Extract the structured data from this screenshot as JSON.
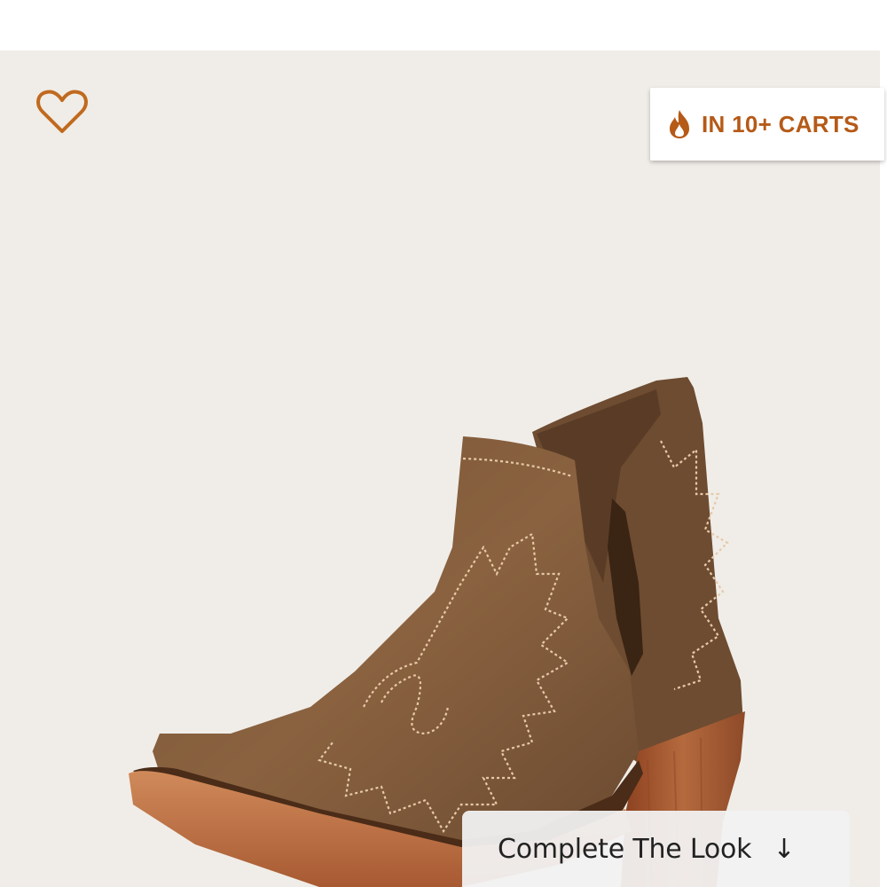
{
  "badge": {
    "text": "IN 10+ CARTS",
    "icon": "flame-icon",
    "color": "#b55a17"
  },
  "favorite": {
    "icon": "heart-outline-icon",
    "color": "#c06a1f"
  },
  "complete_look": {
    "label": "Complete The Look",
    "arrow": "↓",
    "icon": "arrow-down-icon"
  },
  "product_image": {
    "subject": "brown leather western ankle boot"
  },
  "colors": {
    "background": "#f0ede8",
    "accent": "#b55a17"
  }
}
